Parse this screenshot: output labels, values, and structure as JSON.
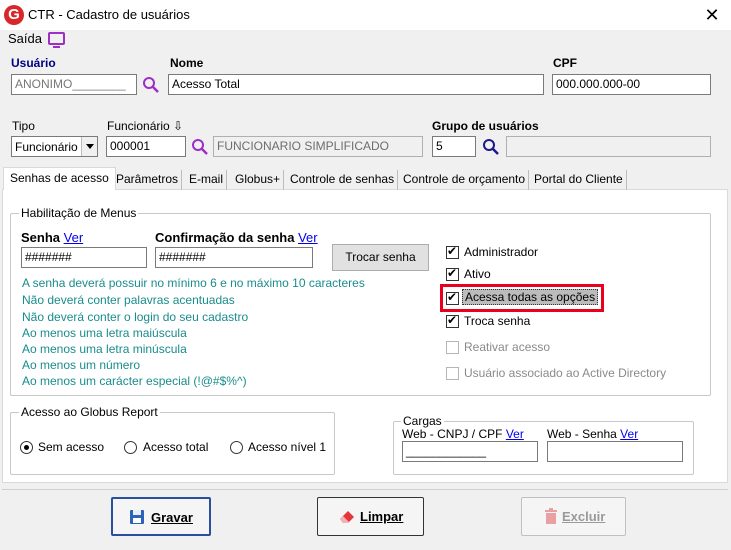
{
  "window": {
    "title": "CTR - Cadastro de usuários",
    "close_label": "✕",
    "app_icon_letter": "G"
  },
  "menu": {
    "saida_label": "Saída"
  },
  "header": {
    "usuario_label": "Usuário",
    "usuario_value": "ANONIMO________",
    "nome_label": "Nome",
    "nome_value": "Acesso Total",
    "cpf_label": "CPF",
    "cpf_value": "000.000.000-00",
    "tipo_label": "Tipo",
    "tipo_value": "Funcionário",
    "funcionario_label": "Funcionário ⇩",
    "funcionario_code": "000001",
    "funcionario_name": "FUNCIONARIO SIMPLIFICADO",
    "grupo_label": "Grupo de usuários",
    "grupo_code": "5",
    "grupo_name": ""
  },
  "tabs": [
    {
      "label": "Senhas de acesso",
      "active": true
    },
    {
      "label": "Parâmetros"
    },
    {
      "label": "E-mail"
    },
    {
      "label": "Globus+"
    },
    {
      "label": "Controle de senhas"
    },
    {
      "label": "Controle de orçamento"
    },
    {
      "label": "Portal do Cliente"
    }
  ],
  "habilitacao": {
    "title": "Habilitação de Menus",
    "senha_label": "Senha",
    "senha_ver": "Ver",
    "senha_value": "#######",
    "confirmacao_label": "Confirmação da senha",
    "confirmacao_ver": "Ver",
    "confirmacao_value": "#######",
    "trocar_button": "Trocar senha",
    "rules": [
      "A senha deverá possuir no mínimo 6 e no máximo 10 caracteres",
      "Não deverá conter palavras acentuadas",
      "Não deverá conter o login do seu cadastro",
      "Ao menos uma letra maiúscula",
      "Ao menos uma letra minúscula",
      "Ao menos um número",
      "Ao menos um carácter especial (!@#$%^)"
    ],
    "checkboxes": [
      {
        "label": "Administrador",
        "checked": true,
        "enabled": true
      },
      {
        "label": "Ativo",
        "checked": true,
        "enabled": true
      },
      {
        "label": "Acessa todas as opções",
        "checked": true,
        "enabled": true
      },
      {
        "label": "Troca senha",
        "checked": true,
        "enabled": true
      },
      {
        "label": "Reativar acesso",
        "checked": false,
        "enabled": false
      },
      {
        "label": "Usuário associado ao Active Directory",
        "checked": false,
        "enabled": false
      }
    ]
  },
  "globus_report": {
    "title": "Acesso ao Globus Report",
    "options": [
      {
        "label": "Sem acesso",
        "checked": true
      },
      {
        "label": "Acesso total",
        "checked": false
      },
      {
        "label": "Acesso nível 1",
        "checked": false
      }
    ]
  },
  "cargas": {
    "title": "Cargas",
    "cnpj_label": "Web - CNPJ / CPF",
    "cnpj_ver": "Ver",
    "cnpj_value": "____________",
    "senha_label": "Web - Senha",
    "senha_ver": "Ver",
    "senha_value": ""
  },
  "footer": {
    "gravar": "Gravar",
    "limpar": "Limpar",
    "excluir": "Excluir"
  },
  "colors": {
    "highlight": "#e8001c",
    "rule_text": "#1a8c8c",
    "link": "#0000ee",
    "accent": "#9b2fc6"
  }
}
